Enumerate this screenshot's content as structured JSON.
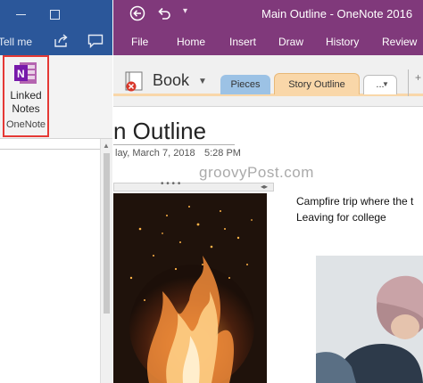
{
  "word": {
    "tell_me": "Tell me",
    "linked_notes": {
      "line1": "Linked",
      "line2": "Notes",
      "group": "OneNote"
    }
  },
  "onenote": {
    "title": "Main Outline  -  OneNote 2016",
    "menu": [
      "File",
      "Home",
      "Insert",
      "Draw",
      "History",
      "Review"
    ],
    "notebook": "Book",
    "sections": {
      "pieces": "Pieces",
      "story": "Story Outline",
      "more": "..."
    },
    "page": {
      "title": "n Outline",
      "date": "lay, March 7, 2018",
      "time": "5:28 PM",
      "watermark": "groovyPost.com",
      "note_line1": "Campfire trip where the t",
      "note_line2": "Leaving for college"
    }
  },
  "colors": {
    "word_blue": "#2b579a",
    "onenote_purple": "#80397b",
    "highlight_red": "#e53935",
    "section_pieces": "#9cc2e5",
    "section_story": "#f9d7a9"
  }
}
